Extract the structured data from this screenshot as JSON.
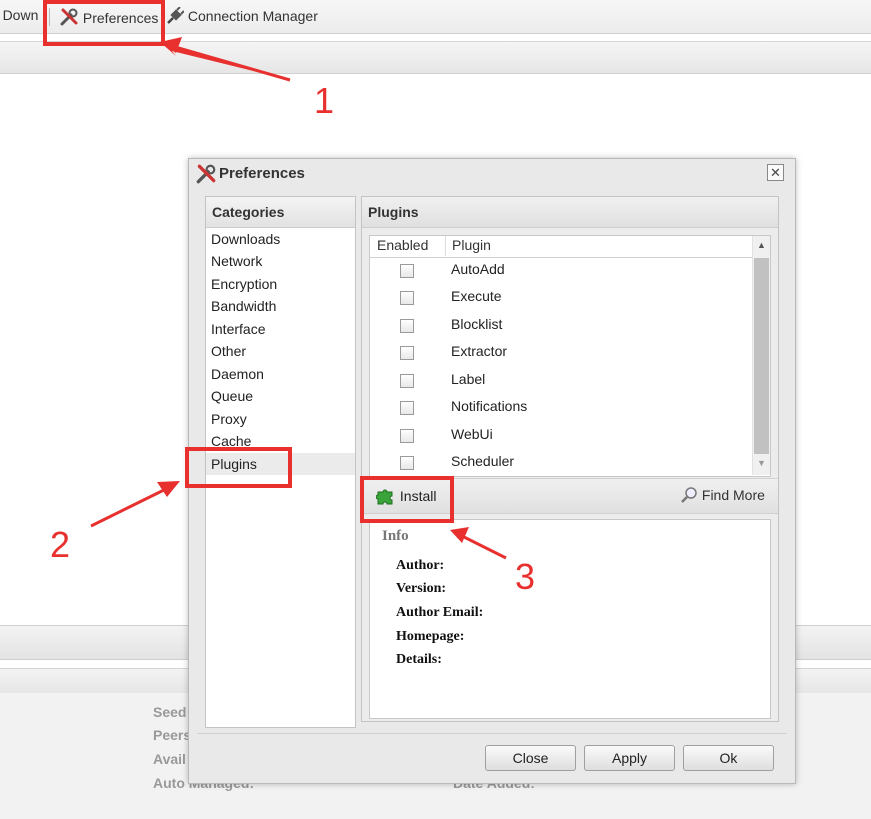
{
  "toolbar": {
    "truncated_item": "Down",
    "preferences_label": "Preferences",
    "connection_manager_label": "Connection Manager"
  },
  "details_bg": {
    "labels": [
      "Seed",
      "Peers",
      "Avail",
      "Auto Managed:",
      "Date Added:"
    ]
  },
  "dialog": {
    "title": "Preferences",
    "close_glyph": "✕",
    "categories": {
      "heading": "Categories",
      "items": [
        "Downloads",
        "Network",
        "Encryption",
        "Bandwidth",
        "Interface",
        "Other",
        "Daemon",
        "Queue",
        "Proxy",
        "Cache",
        "Plugins"
      ],
      "selected": "Plugins"
    },
    "plugins": {
      "heading": "Plugins",
      "columns": [
        "Enabled",
        "Plugin"
      ],
      "rows": [
        {
          "name": "AutoAdd",
          "enabled": false
        },
        {
          "name": "Execute",
          "enabled": false
        },
        {
          "name": "Blocklist",
          "enabled": false
        },
        {
          "name": "Extractor",
          "enabled": false
        },
        {
          "name": "Label",
          "enabled": false
        },
        {
          "name": "Notifications",
          "enabled": false
        },
        {
          "name": "WebUi",
          "enabled": false
        },
        {
          "name": "Scheduler",
          "enabled": false
        }
      ],
      "install_label": "Install",
      "find_more_label": "Find More"
    },
    "info": {
      "title": "Info",
      "author_label": "Author:",
      "version_label": "Version:",
      "author_email_label": "Author Email:",
      "homepage_label": "Homepage:",
      "details_label": "Details:"
    },
    "buttons": {
      "close": "Close",
      "apply": "Apply",
      "ok": "Ok"
    }
  },
  "annotations": {
    "step1": "1",
    "step2": "2",
    "step3": "3",
    "color": "#e8312f"
  },
  "icons": [
    "tools-icon",
    "plug-icon",
    "puzzle-icon",
    "magnifier-icon"
  ]
}
